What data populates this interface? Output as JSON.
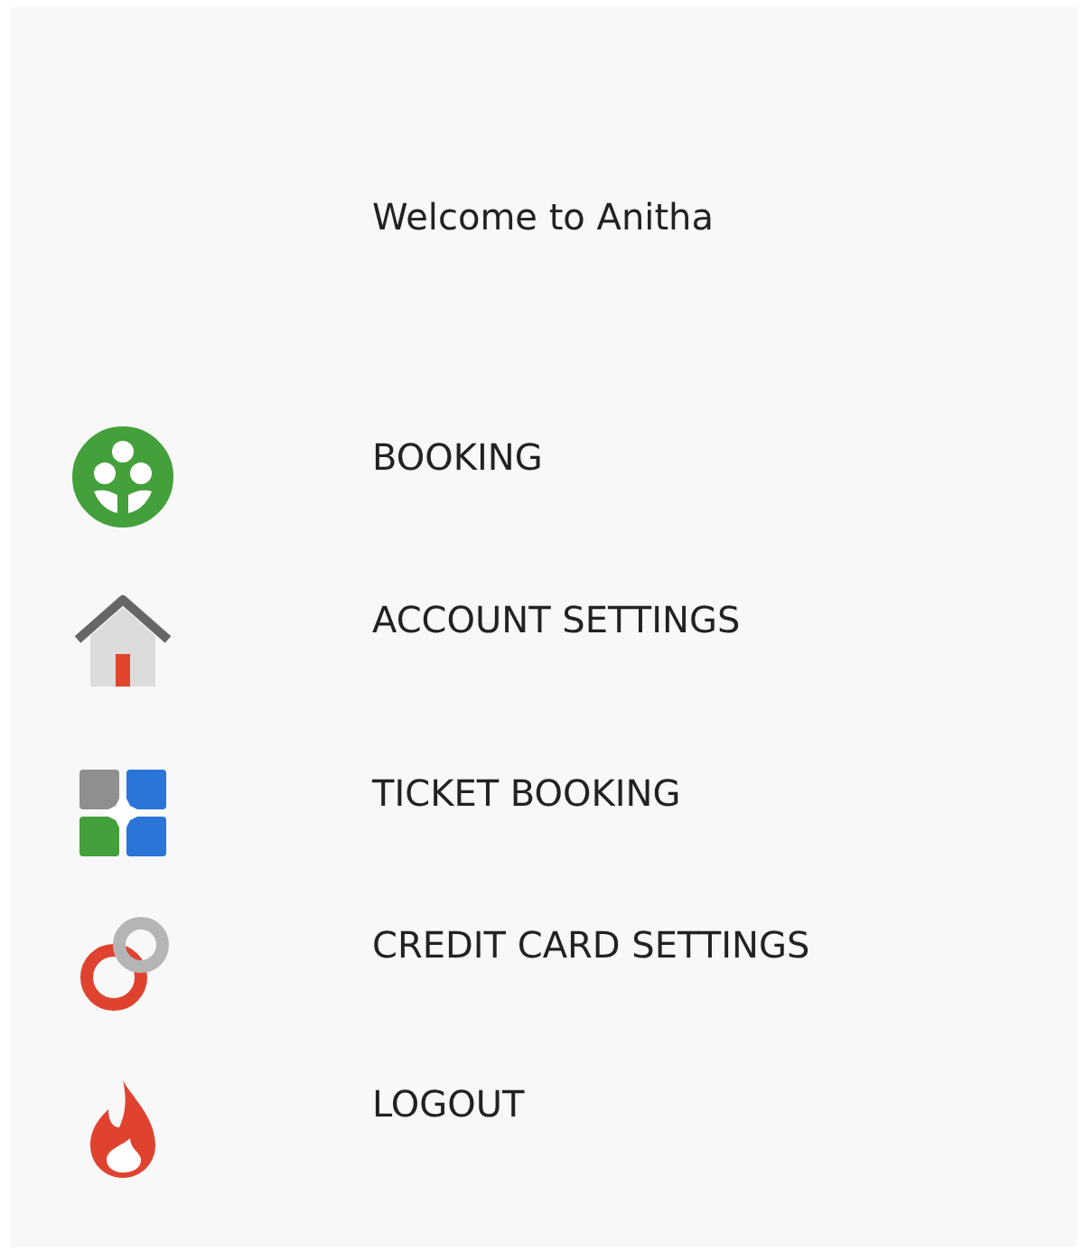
{
  "welcome": "Welcome to Anitha",
  "menu": [
    {
      "label": "BOOKING"
    },
    {
      "label": "ACCOUNT SETTINGS"
    },
    {
      "label": "TICKET BOOKING"
    },
    {
      "label": "CREDIT CARD SETTINGS"
    },
    {
      "label": "LOGOUT"
    }
  ]
}
